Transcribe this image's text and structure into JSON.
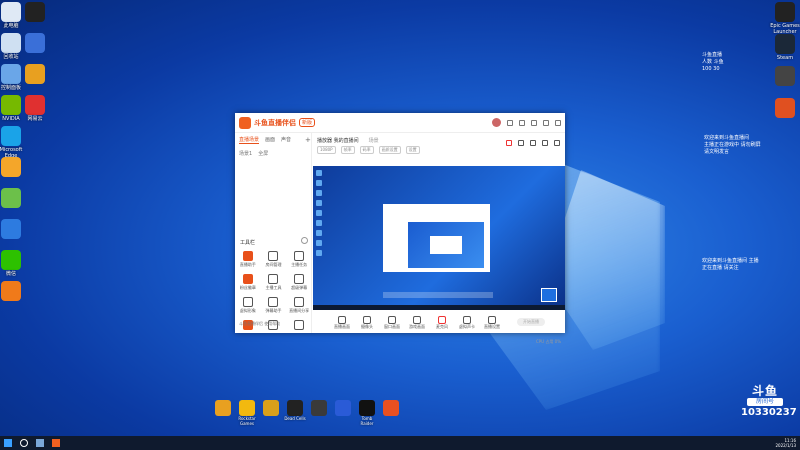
{
  "desktop": {
    "icons_left": [
      {
        "label": "此电脑",
        "color": "#dfe9f5"
      },
      {
        "label": "回收站",
        "color": "#cfe0f2"
      },
      {
        "label": "控制面板",
        "color": "#6aa6e8"
      },
      {
        "label": "NVIDIA",
        "color": "#76b900"
      },
      {
        "label": "Microsoft Edge",
        "color": "#1aa3e8"
      },
      {
        "label": "",
        "color": "#f4a62a"
      },
      {
        "label": "",
        "color": "#6cc04a"
      },
      {
        "label": "",
        "color": "#2d7be0"
      },
      {
        "label": "微信",
        "color": "#2dc100"
      },
      {
        "label": "",
        "color": "#f07a1a"
      }
    ],
    "icons_left2": [
      {
        "label": "",
        "color": "#222"
      },
      {
        "label": "",
        "color": "#3a6fd8"
      },
      {
        "label": "",
        "color": "#e8a020"
      },
      {
        "label": "网易云",
        "color": "#e03030"
      }
    ],
    "icons_right": [
      {
        "label": "Epic Games Launcher",
        "color": "#222222"
      },
      {
        "label": "Steam",
        "color": "#1b2838"
      },
      {
        "label": "",
        "color": "#444"
      },
      {
        "label": "",
        "color": "#e05020"
      }
    ],
    "dock": [
      {
        "label": "",
        "color": "#e8a020"
      },
      {
        "label": "Rockstar Games",
        "color": "#f2b90f"
      },
      {
        "label": "",
        "color": "#d9a01a"
      },
      {
        "label": "Dead Cells",
        "color": "#222"
      },
      {
        "label": "",
        "color": "#3a3a3a"
      },
      {
        "label": "",
        "color": "#2a5bd7"
      },
      {
        "label": "Tomb Raider",
        "color": "#111"
      },
      {
        "label": "",
        "color": "#e85020"
      }
    ]
  },
  "overlay": {
    "top_right": [
      "斗鱼直播",
      "人数 斗鱼",
      "100 30"
    ],
    "mid_right": [
      "欢迎来到斗鱼直播间",
      "主播正在游戏中 请勿刷屏",
      "请文明发言"
    ],
    "lower_right": [
      "欢迎来到斗鱼直播间 主播",
      "正在直播 请关注"
    ]
  },
  "app": {
    "brand": "斗鱼直播伴侣",
    "badge": "新版",
    "sidebar_tabs": [
      "直播场景",
      "画面",
      "声音"
    ],
    "sidebar_row": [
      "场景1",
      "全屏"
    ],
    "tools_heading": "工具栏",
    "tools": [
      "直播助手",
      "房间管理",
      "主播任务",
      "粉丝徽章",
      "主播工具",
      "超级弹幕",
      "虚拟形象",
      "弹幕助手",
      "直播间分享",
      "",
      "",
      ""
    ],
    "sidebar_footer": "斗鱼直播伴侣 使用帮助",
    "main_tabs": [
      "播放器 我的直播间",
      "场景"
    ],
    "main_tools": [
      "1080P",
      "帧率",
      "码率",
      "画质设置",
      "设置"
    ],
    "controls": [
      "直播画面",
      "摄像头",
      "窗口画面",
      "游戏画面",
      "麦克风",
      "虚拟声卡",
      "直播设置"
    ],
    "start_button": "开始直播",
    "status": "CPU 占用 0%"
  },
  "watermark": {
    "brand": "斗鱼",
    "tag": "房间号",
    "room": "10330237"
  },
  "taskbar": {
    "time": "11:16",
    "date": "2022/1/13"
  }
}
